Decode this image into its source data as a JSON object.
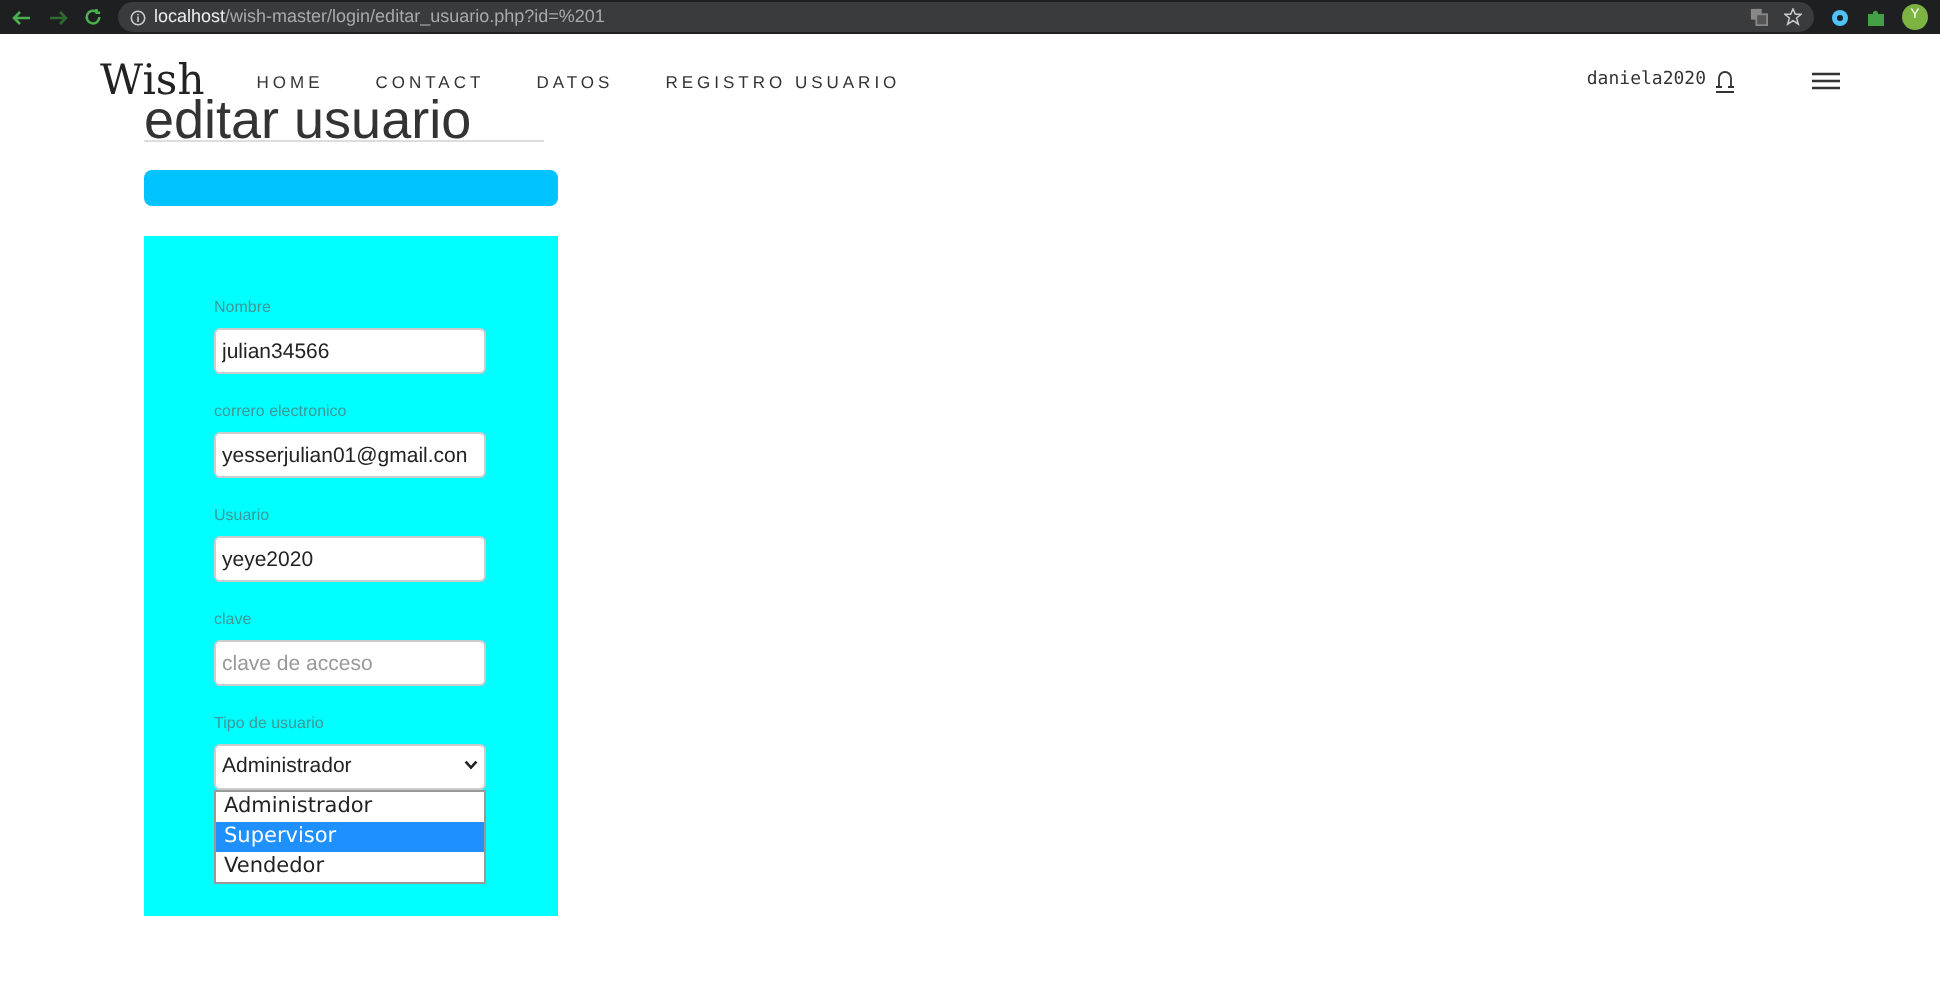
{
  "browser": {
    "url_host": "localhost",
    "url_path": "/wish-master/login/editar_usuario.php?id=%201",
    "profile_initial": "Y"
  },
  "navbar": {
    "brand": "Wish",
    "links": [
      "HOME",
      "CONTACT",
      "DATOS",
      "REGISTRO USUARIO"
    ],
    "user": "daniela2020"
  },
  "page_title": "editar usuario",
  "form": {
    "fields": [
      {
        "kind": "text",
        "label": "Nombre",
        "value": "julian34566"
      },
      {
        "kind": "text",
        "label": "correro electronico",
        "value": "yesserjulian01@gmail.con"
      },
      {
        "kind": "text",
        "label": "Usuario",
        "value": "yeye2020"
      },
      {
        "kind": "password",
        "label": "clave",
        "placeholder": "clave de acceso"
      },
      {
        "kind": "select",
        "label": "Tipo de usuario",
        "value": "Administrador",
        "expanded": true,
        "options": [
          {
            "label": "Administrador",
            "highlighted": false
          },
          {
            "label": "Supervisor",
            "highlighted": true
          },
          {
            "label": "Vendedor",
            "highlighted": false
          }
        ]
      }
    ]
  }
}
